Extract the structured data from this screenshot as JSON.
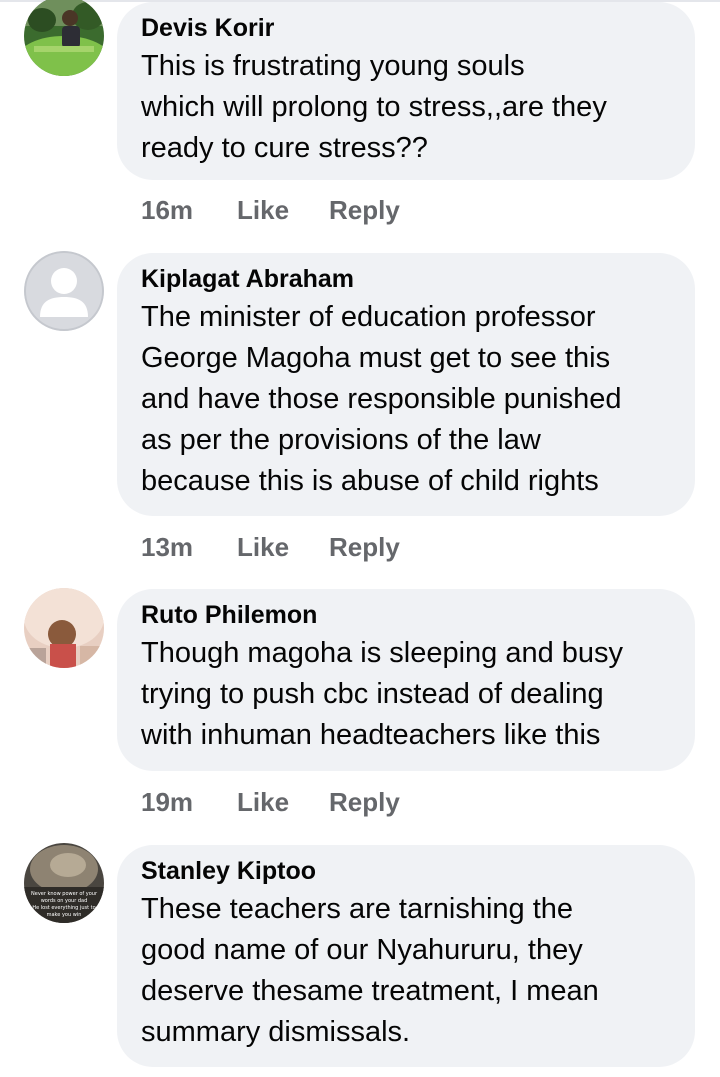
{
  "comments": [
    {
      "author": "Devis Korir",
      "text": "This is frustrating young souls\nwhich will prolong to stress,,are they\nready to cure stress??",
      "time": "16m",
      "like_label": "Like",
      "reply_label": "Reply",
      "avatar": "landscape-photo-avatar"
    },
    {
      "author": "Kiplagat Abraham",
      "text": "The minister of education professor\nGeorge Magoha must get to see this\nand have those responsible punished\nas per the provisions of the law\nbecause this is abuse of child rights",
      "time": "13m",
      "like_label": "Like",
      "reply_label": "Reply",
      "avatar": "default-person-avatar"
    },
    {
      "author": "Ruto Philemon",
      "text": "Though magoha is sleeping and busy\ntrying to push cbc instead of dealing\nwith inhuman headteachers like this",
      "time": "19m",
      "like_label": "Like",
      "reply_label": "Reply",
      "avatar": "portrait-photo-avatar"
    },
    {
      "author": "Stanley Kiptoo",
      "text": "These teachers are tarnishing the\ngood name of our Nyahururu, they\ndeserve thesame treatment, I mean\nsummary dismissals.",
      "time": "",
      "like_label": "",
      "reply_label": "",
      "avatar": "quote-photo-avatar",
      "avatar_caption": "Never know power of your words on your dad He lost everything just to make you win"
    }
  ],
  "colors": {
    "bubble_bg": "#f0f2f5",
    "meta_text": "#65676b",
    "text": "#050505"
  }
}
